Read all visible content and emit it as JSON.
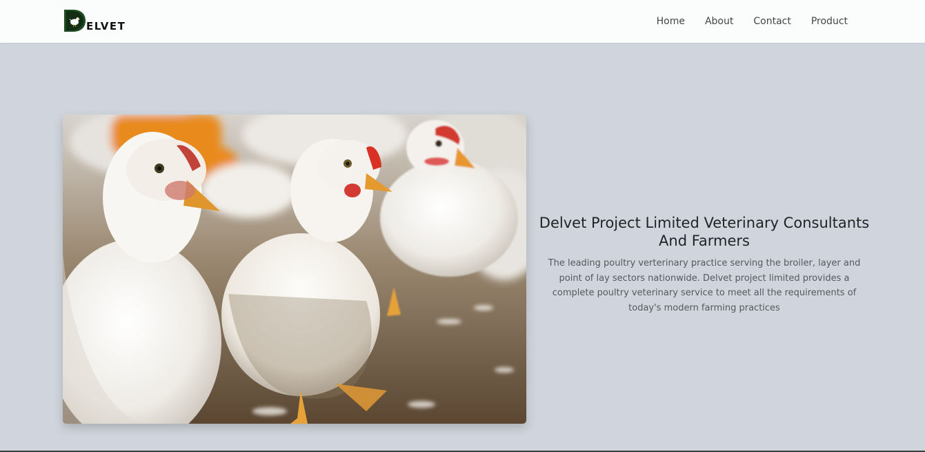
{
  "navbar": {
    "brand": {
      "logo_letter": "D",
      "text": "ELVET"
    },
    "links": [
      {
        "label": "Home"
      },
      {
        "label": "About"
      },
      {
        "label": "Contact"
      },
      {
        "label": "Product"
      }
    ]
  },
  "hero": {
    "title": "Delvet Project Limited Veterinary Consultants And Farmers",
    "description": "The leading poultry verterinary practice serving the broiler, layer and point of lay sectors nationwide. Delvet project limited provides a complete poultry veterinary service to meet all the requirements of today's modern farming practices"
  },
  "colors": {
    "navbar_bg": "#fbfdfc",
    "page_bg": "#d0d4dc",
    "logo_green": "#1e4d22",
    "title_text": "#1f2326",
    "body_text": "#55595e"
  }
}
